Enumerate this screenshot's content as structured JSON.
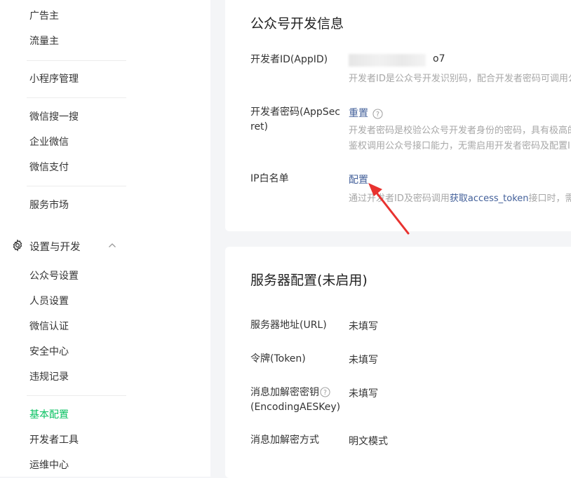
{
  "sidebar": {
    "items_top": [
      "广告主",
      "流量主"
    ],
    "mini_program": "小程序管理",
    "search": "微信搜一搜",
    "work_wechat": "企业微信",
    "pay": "微信支付",
    "market": "服务市场",
    "group_label": "设置与开发",
    "settings_items": [
      "公众号设置",
      "人员设置",
      "微信认证",
      "安全中心",
      "违规记录"
    ],
    "basic_config": "基本配置",
    "dev_tools": "开发者工具",
    "ops_center": "运维中心"
  },
  "dev_info": {
    "title": "公众号开发信息",
    "appid_label": "开发者ID(AppID)",
    "appid_suffix": "o7",
    "appid_desc": "开发者ID是公众号开发识别码，配合开发者密码可调用公",
    "secret_label_1": "开发者密码(AppSec",
    "secret_label_2": "ret)",
    "secret_action": "重置",
    "secret_desc_1": "开发者密码是校验公众号开发者身份的密码，具有极高的",
    "secret_desc_2": "鉴权调用公众号接口能力，无需启用开发者密码及配置IP白",
    "ip_label": "IP白名单",
    "ip_action": "配置",
    "ip_desc_prefix": "通过开发者ID及密码调用",
    "ip_desc_link": "获取access_token",
    "ip_desc_suffix": "接口时，需要"
  },
  "server_config": {
    "title": "服务器配置(未启用)",
    "url_label": "服务器地址(URL)",
    "url_value": "未填写",
    "token_label": "令牌(Token)",
    "token_value": "未填写",
    "aes_label_1": "消息加解密密钥",
    "aes_label_2": "(EncodingAESKey)",
    "aes_value": "未填写",
    "mode_label": "消息加解密方式",
    "mode_value": "明文模式"
  },
  "colors": {
    "accent_green": "#07c160",
    "link_blue": "#43609a",
    "arrow_red": "#e8322f"
  }
}
